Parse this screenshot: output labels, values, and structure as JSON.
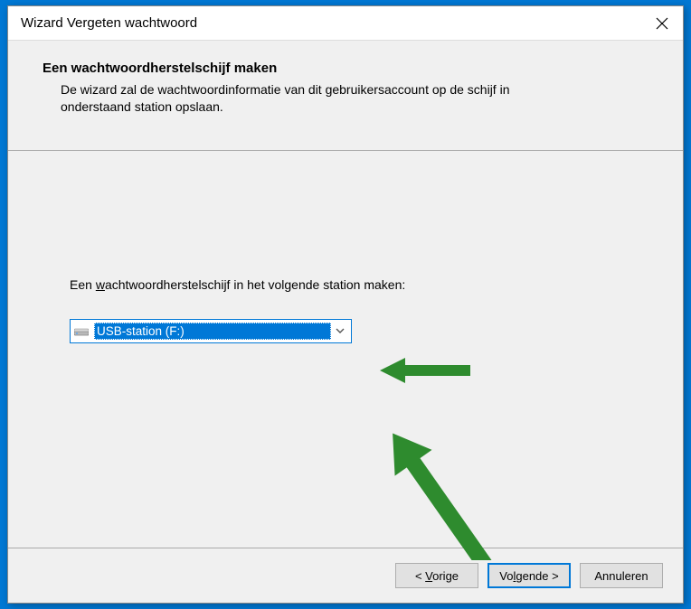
{
  "titlebar": {
    "title": "Wizard Vergeten wachtwoord"
  },
  "header": {
    "title": "Een wachtwoordherstelschijf maken",
    "subtitle": "De wizard zal de wachtwoordinformatie van dit gebruikersaccount op de schijf in onderstaand station opslaan."
  },
  "content": {
    "instruction_prefix": "Een ",
    "instruction_underline": "w",
    "instruction_suffix": "achtwoordherstelschijf in het volgende station maken:",
    "selected_drive": "USB-station (F:)"
  },
  "footer": {
    "back_prefix": "< ",
    "back_underline": "V",
    "back_suffix": "orige",
    "next_prefix": "Vo",
    "next_underline": "l",
    "next_suffix": "gende >",
    "cancel": "Annuleren"
  }
}
